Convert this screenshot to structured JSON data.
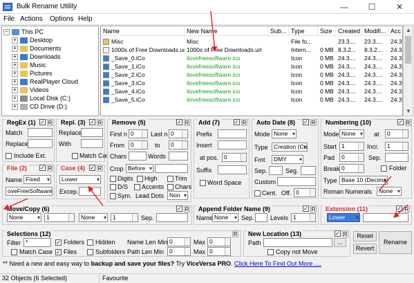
{
  "window": {
    "title": "Bulk Rename Utility",
    "minimize": "—",
    "maximize": "☐",
    "close": "✕"
  },
  "menu": [
    "File",
    "Actions",
    "Options",
    "Help"
  ],
  "tree": [
    {
      "label": "This PC",
      "icon": "computer-icon",
      "color": "#5a8fd0"
    },
    {
      "label": "Desktop",
      "icon": "desktop-folder-icon",
      "color": "#3b7bd0"
    },
    {
      "label": "Documents",
      "icon": "documents-folder-icon",
      "color": "#e7c45c"
    },
    {
      "label": "Downloads",
      "icon": "downloads-folder-icon",
      "color": "#3b7bd0"
    },
    {
      "label": "Music",
      "icon": "music-folder-icon",
      "color": "#e7c45c"
    },
    {
      "label": "Pictures",
      "icon": "pictures-folder-icon",
      "color": "#e7c45c"
    },
    {
      "label": "RealPlayer Cloud",
      "icon": "cloud-folder-icon",
      "color": "#3b7bd0"
    },
    {
      "label": "Videos",
      "icon": "videos-folder-icon",
      "color": "#e7c45c"
    },
    {
      "label": "Local Disk (C:)",
      "icon": "drive-icon",
      "color": "#8a8a8a"
    },
    {
      "label": "CD Drive (D:)",
      "icon": "cd-drive-icon",
      "color": "#b0b0b0"
    }
  ],
  "columns": [
    "Name",
    "New Name",
    "Sub...",
    "Type",
    "Size",
    "Created",
    "Modifi...",
    "Acc"
  ],
  "files": [
    {
      "name": "Misc",
      "newname": "Misc",
      "type": "File fo...",
      "size": "",
      "created": "23.3....",
      "modified": "23.3....",
      "accessed": "24.3.",
      "green": false,
      "icon": "folder-icon"
    },
    {
      "name": "1000s of Free Downloads.url",
      "newname": "1000s of Free Downloads.url",
      "type": "Intern...",
      "size": "0 MB",
      "created": "8.3.2...",
      "modified": "8.3.2...",
      "accessed": "24.3.",
      "green": false,
      "icon": "url-file-icon"
    },
    {
      "name": "_Save_0.iCo",
      "newname": "ilovefreesoftware.ico",
      "type": "Icon",
      "size": "0 MB",
      "created": "24.3....",
      "modified": "24.3....",
      "accessed": "24.3.",
      "green": true,
      "icon": "ico-file-icon"
    },
    {
      "name": "_Save_1.iCo",
      "newname": "ilovefreesoftware.ico",
      "type": "Icon",
      "size": "0 MB",
      "created": "24.3....",
      "modified": "24.3....",
      "accessed": "24.3.",
      "green": true,
      "icon": "ico-file-icon"
    },
    {
      "name": "_Save_2.iCo",
      "newname": "ilovefreesoftware.ico",
      "type": "Icon",
      "size": "0 MB",
      "created": "24.3....",
      "modified": "24.3....",
      "accessed": "24.3.",
      "green": true,
      "icon": "ico-file-icon"
    },
    {
      "name": "_Save_3.iCo",
      "newname": "ilovefreesoftware.ico",
      "type": "Icon",
      "size": "0 MB",
      "created": "24.3....",
      "modified": "24.3....",
      "accessed": "24.3.",
      "green": true,
      "icon": "ico-file-icon"
    },
    {
      "name": "_Save_4.iCo",
      "newname": "ilovefreesoftware.ico",
      "type": "Icon",
      "size": "0 MB",
      "created": "24.3....",
      "modified": "24.3....",
      "accessed": "24.3.",
      "green": true,
      "icon": "ico-file-icon"
    },
    {
      "name": "_Save_5.iCo",
      "newname": "ilovefreesoftware.ico",
      "type": "Icon",
      "size": "0 MB",
      "created": "24.3....",
      "modified": "24.3....",
      "accessed": "24.3.",
      "green": true,
      "icon": "ico-file-icon"
    }
  ],
  "regex": {
    "title": "RegEx (1)",
    "match": "Match",
    "replace": "Replace",
    "include_ext": "Include Ext."
  },
  "repl": {
    "title": "Repl. (3)",
    "replace": "Replace",
    "with": "With",
    "match_case": "Match Case"
  },
  "remove": {
    "title": "Remove (5)",
    "first_n": "First n",
    "last_n": "Last n",
    "from": "From",
    "to": "to",
    "chars": "Chars",
    "words": "Words",
    "crop": "Crop",
    "crop_value": "Before",
    "digits": "Digits",
    "high": "High",
    "trim": "Trim",
    "ds": "D/S",
    "accents": "Accents",
    "chars2": "Chars",
    "sym": "Sym.",
    "lead_dots": "Lead Dots",
    "lead_value": "Non",
    "n0": "0",
    "n1": "0",
    "n2": "0",
    "n3": "0"
  },
  "add": {
    "title": "Add (7)",
    "prefix": "Prefix",
    "insert": "Insert",
    "at_pos": "at pos.",
    "at_pos_value": "0",
    "suffix": "Suffix",
    "word_space": "Word Space"
  },
  "autodate": {
    "title": "Auto Date (8)",
    "mode": "Mode",
    "mode_value": "None",
    "type": "Type",
    "type_value": "Creation (Cur",
    "fmt": "Fmt",
    "fmt_value": "DMY",
    "sep": "Sep.",
    "seg": "Seg.",
    "custom": "Custom",
    "cent": "Cent.",
    "off": "Off.",
    "off_value": "0"
  },
  "numbering": {
    "title": "Numbering (10)",
    "mode": "Mode",
    "mode_value": "None",
    "at": "at",
    "at_value": "0",
    "start": "Start",
    "start_value": "1",
    "incr": "Incr.",
    "incr_value": "1",
    "pad": "Pad",
    "pad_value": "0",
    "sep": "Sep.",
    "break": "Break",
    "break_value": "0",
    "folder": "Folder",
    "type": "Type",
    "type_value": "Base 10 (Decimal)",
    "roman": "Roman Numerals",
    "roman_value": "None"
  },
  "file": {
    "title": "File (2)",
    "name": "Name",
    "name_value": "Fixed",
    "field_value": "oveFreeSoftware"
  },
  "case": {
    "title": "Case (4)",
    "value": "Lower",
    "excep": "Excep."
  },
  "movecopy": {
    "title": "Move/Copy (6)",
    "v1": "None",
    "n1": "1",
    "v2": "None",
    "n2": "1",
    "sep": "Sep."
  },
  "appendfolder": {
    "title": "Append Folder Name (9)",
    "name": "Name",
    "name_value": "None",
    "sep": "Sep.",
    "levels": "Levels",
    "levels_value": "1"
  },
  "extension": {
    "title": "Extension (11)",
    "value": "Lower"
  },
  "selections": {
    "title": "Selections (12)",
    "filter": "Filter",
    "filter_value": "*",
    "folders": "Folders",
    "hidden": "Hidden",
    "name_len_min": "Name Len Min",
    "nlm_value": "0",
    "max": "Max",
    "max1_value": "0",
    "match_case": "Match Case",
    "files": "Files",
    "subfolders": "Subfolders",
    "path_len_min": "Path Len Min",
    "plm_value": "0",
    "max2_value": "0"
  },
  "newlocation": {
    "title": "New Location (13)",
    "path": "Path",
    "browse": "...",
    "copy_not_move": "Copy not Move"
  },
  "buttons": {
    "reset": "Reset",
    "revert": "Revert",
    "rename": "Rename"
  },
  "tip": {
    "prefix": "** Need a new and easy way to ",
    "bold1": "backup and save your files?",
    "mid": " Try ",
    "bold2": "ViceVersa PRO",
    "after": ". ",
    "link": "Click Here To Find Out More ...."
  },
  "status": {
    "objects": "32 Objects (6 Selected)",
    "favourite": "Favourite"
  },
  "colors": {
    "arrow": "#e02020",
    "accent": "#3d7bd6",
    "new_name_green": "#1a9b1a"
  }
}
